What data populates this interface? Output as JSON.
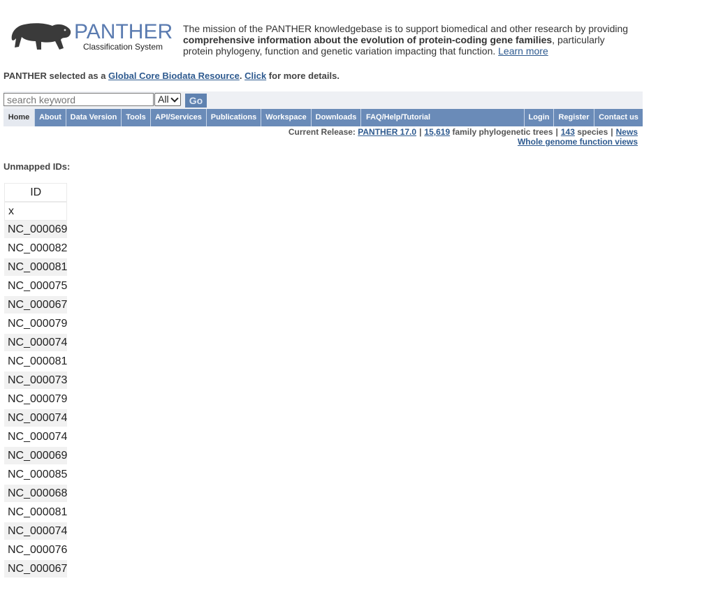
{
  "logo": {
    "title": "PANTHER",
    "subtitle": "Classification System"
  },
  "mission": {
    "part1": "The mission of the PANTHER knowledgebase is to support biomedical and other research by providing ",
    "bold": "comprehensive information about the evolution of protein-coding gene families",
    "part2": ", particularly protein phylogeny, function and genetic variation impacting that function. ",
    "link": "Learn more"
  },
  "core": {
    "prefix": "PANTHER selected as a ",
    "link1": "Global Core Biodata Resource",
    "mid": ". ",
    "link2": "Click",
    "suffix": " for more details."
  },
  "search": {
    "placeholder": "search keyword",
    "scope": "All",
    "go_label": "Go"
  },
  "nav": {
    "left": [
      "Home",
      "About",
      "Data Version",
      "Tools",
      "API/Services",
      "Publications",
      "Workspace",
      "Downloads",
      "FAQ/Help/Tutorial"
    ],
    "right": [
      "Login",
      "Register",
      "Contact us"
    ]
  },
  "release": {
    "label": "Current Release: ",
    "version": "PANTHER 17.0",
    "trees_count": "15,619",
    "trees_label": " family phylogenetic trees",
    "species_count": "143",
    "species_label": " species",
    "news": "News",
    "sep": "|",
    "genome_link": "Whole genome function views"
  },
  "unmapped_label": "Unmapped IDs:",
  "table": {
    "header": "ID",
    "rows": [
      "x",
      "NC_000069",
      "NC_000082",
      "NC_000081",
      "NC_000075",
      "NC_000067",
      "NC_000079",
      "NC_000074",
      "NC_000081",
      "NC_000073",
      "NC_000079",
      "NC_000074",
      "NC_000074",
      "NC_000069",
      "NC_000085",
      "NC_000068",
      "NC_000081",
      "NC_000074",
      "NC_000076",
      "NC_000067"
    ]
  },
  "colors": {
    "nav_bg": "#6a8bb8",
    "link": "#2e5a8f",
    "logo": "#5a7bb0"
  }
}
